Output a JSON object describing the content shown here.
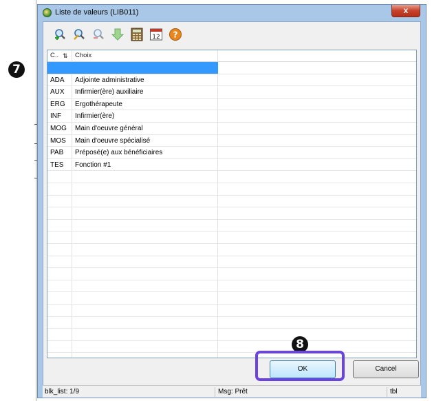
{
  "callouts": {
    "seven": "7",
    "eight": "8"
  },
  "dialog": {
    "title": "Liste de valeurs (LIB011)",
    "close_label": "x"
  },
  "toolbar": {
    "icons": [
      "search-add-icon",
      "search-edit-icon",
      "search-remove-icon",
      "download-arrow-icon",
      "calculator-icon",
      "calendar-icon",
      "help-icon"
    ],
    "calendar_text": "12",
    "help_text": "?"
  },
  "table": {
    "headers": {
      "code": "C..",
      "choice": "Choix"
    },
    "rows": [
      {
        "code": "",
        "choice": ""
      },
      {
        "code": "ADA",
        "choice": "Adjointe administrative"
      },
      {
        "code": "AUX",
        "choice": "Infirmier(ère) auxiliaire"
      },
      {
        "code": "ERG",
        "choice": "Ergothérapeute"
      },
      {
        "code": "INF",
        "choice": "Infirmier(ère)"
      },
      {
        "code": "MOG",
        "choice": "Main d'oeuvre général"
      },
      {
        "code": "MOS",
        "choice": "Main d'oeuvre spécialisé"
      },
      {
        "code": "PAB",
        "choice": "Préposé(e) aux bénéficiaires"
      },
      {
        "code": "TES",
        "choice": "Fonction #1"
      }
    ]
  },
  "buttons": {
    "ok": "OK",
    "cancel": "Cancel"
  },
  "status": {
    "list": "blk_list: 1/9",
    "msg": "Msg: Prêt",
    "mode": "tbl"
  },
  "colors": {
    "selection": "#3399ff",
    "highlight_frame": "#6a44e0",
    "title_bar": "#a9c7e6"
  }
}
